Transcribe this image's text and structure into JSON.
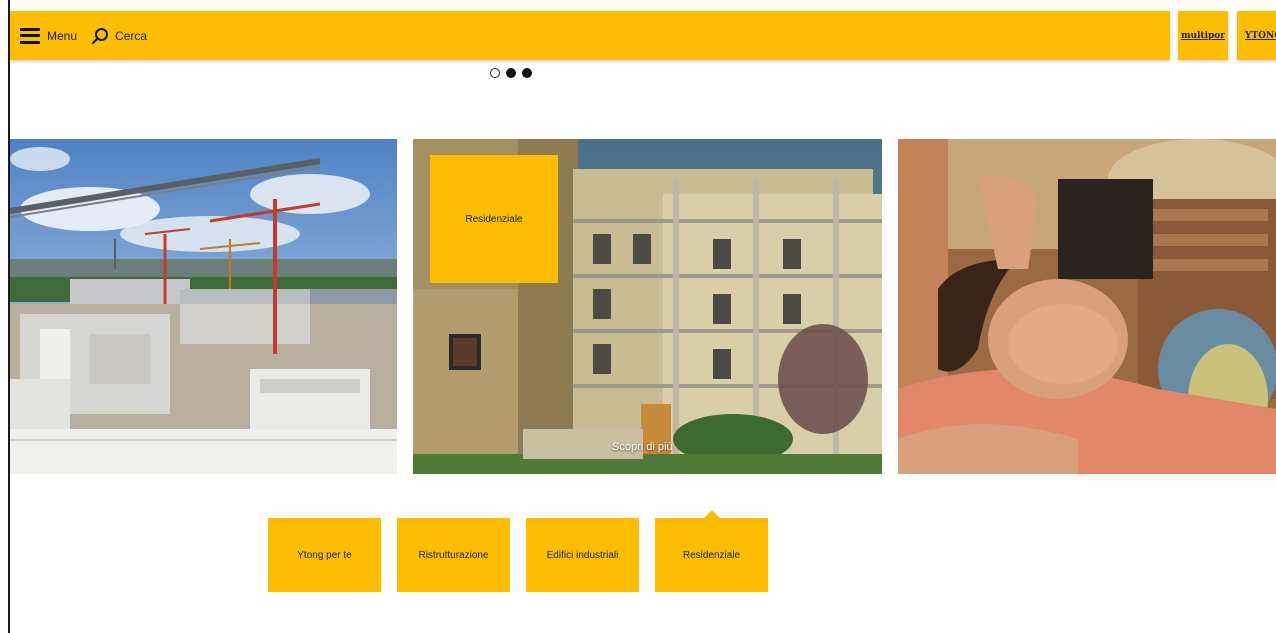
{
  "header": {
    "menu_label": "Menu",
    "search_label": "Cerca",
    "brand_tabs": [
      "multipor",
      "YTONG"
    ]
  },
  "carousel": {
    "dot_count": 3,
    "active_dot": 0,
    "active_slide": {
      "badge": "Residenziale",
      "link": "Scopri di più"
    }
  },
  "categories": [
    "Ytong per te",
    "Ristrutturazione",
    "Edifici industriali",
    "Residenziale"
  ],
  "colors": {
    "accent": "#fdbd00",
    "text": "#222222",
    "background": "#ffffff"
  },
  "icons": {
    "menu": "hamburger-icon",
    "search": "search-icon"
  }
}
